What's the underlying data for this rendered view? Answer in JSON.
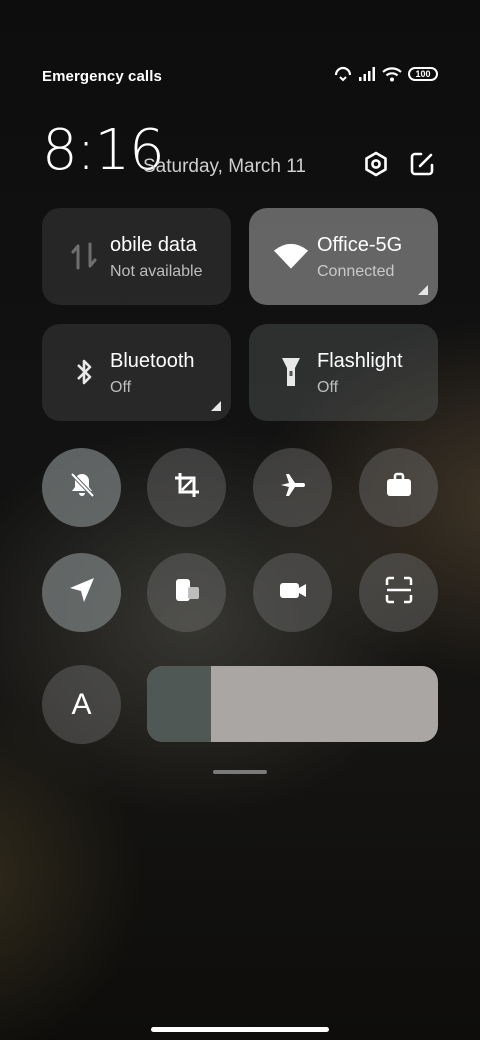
{
  "status_bar": {
    "carrier_text": "Emergency calls o",
    "battery": "100"
  },
  "header": {
    "time": "8:16",
    "date": "Saturday, March 11"
  },
  "tiles": [
    {
      "name": "Mobile data",
      "visible_name": "obile data",
      "subtitle": "Not available",
      "state": "off",
      "icon": "mobile-data-icon"
    },
    {
      "name": "Office-5G",
      "visible_name": "Office-5G",
      "subtitle": "Connected",
      "state": "on",
      "icon": "wifi-icon"
    },
    {
      "name": "Bluetooth",
      "visible_name": "Bluetooth",
      "subtitle": "Off",
      "state": "off",
      "icon": "bluetooth-icon"
    },
    {
      "name": "Flashlight",
      "visible_name": "Flashlight",
      "subtitle": "Off",
      "state": "off",
      "icon": "flashlight-icon"
    }
  ],
  "toggles_row1": [
    {
      "icon": "mute-bell-icon",
      "state": "on"
    },
    {
      "icon": "crop-icon",
      "state": "off"
    },
    {
      "icon": "airplane-icon",
      "state": "off"
    },
    {
      "icon": "briefcase-icon",
      "state": "off"
    }
  ],
  "toggles_row2": [
    {
      "icon": "location-icon",
      "state": "on"
    },
    {
      "icon": "screen-cast-icon",
      "state": "off"
    },
    {
      "icon": "video-camera-icon",
      "state": "off"
    },
    {
      "icon": "scan-icon",
      "state": "off"
    }
  ],
  "brightness": {
    "auto_label": "A",
    "level_fraction": 0.22
  },
  "colors": {
    "tile_on": "#a9abaa",
    "tile_off": "#2b2b2b",
    "toggle_on": "#5d6463"
  }
}
